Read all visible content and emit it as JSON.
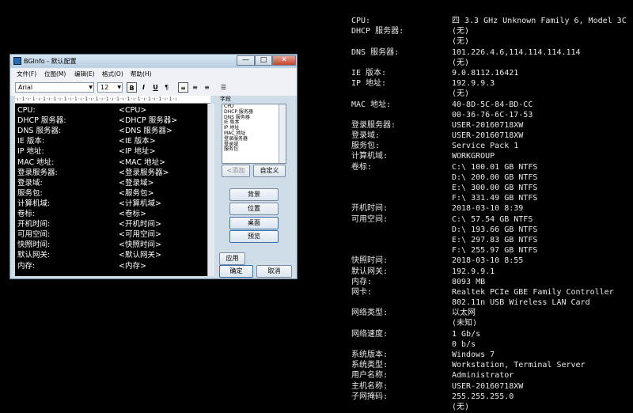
{
  "info": [
    {
      "k": "CPU:",
      "v": "四 3.3 GHz Unknown Family 6, Model 3C"
    },
    {
      "k": "DHCP 服务器:",
      "v": "(无)"
    },
    {
      "k": "",
      "v": "(无)"
    },
    {
      "k": "DNS 服务器:",
      "v": "101.226.4.6,114.114.114.114"
    },
    {
      "k": "",
      "v": "(无)"
    },
    {
      "k": "IE 版本:",
      "v": "9.0.8112.16421"
    },
    {
      "k": "IP 地址:",
      "v": "192.9.9.3"
    },
    {
      "k": "",
      "v": "(无)"
    },
    {
      "k": "MAC 地址:",
      "v": "40-8D-5C-84-BD-CC"
    },
    {
      "k": "",
      "v": "00-36-76-6C-17-53"
    },
    {
      "k": "登录服务器:",
      "v": "USER-20160718XW"
    },
    {
      "k": "登录域:",
      "v": "USER-20160718XW"
    },
    {
      "k": "服务包:",
      "v": "Service Pack 1"
    },
    {
      "k": "计算机域:",
      "v": "WORKGROUP"
    },
    {
      "k": "卷标:",
      "v": "C:\\ 100.01 GB NTFS"
    },
    {
      "k": "",
      "v": "D:\\ 200.00 GB NTFS"
    },
    {
      "k": "",
      "v": "E:\\ 300.00 GB NTFS"
    },
    {
      "k": "",
      "v": "F:\\ 331.49 GB NTFS"
    },
    {
      "k": "开机时间:",
      "v": "2018-03-10 8:39"
    },
    {
      "k": "可用空间:",
      "v": "C:\\ 57.54 GB NTFS"
    },
    {
      "k": "",
      "v": "D:\\ 193.66 GB NTFS"
    },
    {
      "k": "",
      "v": "E:\\ 297.83 GB NTFS"
    },
    {
      "k": "",
      "v": "F:\\ 255.97 GB NTFS"
    },
    {
      "k": "快照时间:",
      "v": "2018-03-10 8:55"
    },
    {
      "k": "默认网关:",
      "v": "192.9.9.1"
    },
    {
      "k": "内存:",
      "v": "8093 MB"
    },
    {
      "k": "网卡:",
      "v": "Realtek PCIe GBE Family Controller"
    },
    {
      "k": "",
      "v": "802.11n USB Wireless LAN Card"
    },
    {
      "k": "网络类型:",
      "v": "以太网"
    },
    {
      "k": "",
      "v": "(未知)"
    },
    {
      "k": "网络速度:",
      "v": "1 Gb/s"
    },
    {
      "k": "",
      "v": "0 b/s"
    },
    {
      "k": "系统版本:",
      "v": "Windows 7"
    },
    {
      "k": "系统类型:",
      "v": "Workstation, Terminal Server"
    },
    {
      "k": "用户名称:",
      "v": "Administrator"
    },
    {
      "k": "主机名称:",
      "v": "USER-20160718XW"
    },
    {
      "k": "子网掩码:",
      "v": "255.255.255.0"
    },
    {
      "k": "",
      "v": "(无)"
    }
  ],
  "window": {
    "title": "BGInfo - 默认配置",
    "min": "—",
    "max": "□",
    "close": "✕",
    "menus": [
      "文件(F)",
      "位图(M)",
      "编辑(E)",
      "格式(O)",
      "帮助(H)"
    ],
    "font": "Arial",
    "size": "12",
    "bold": "B",
    "italic": "I",
    "underline": "U",
    "ruler": "·ı·1·ı·1·ı·1·ı·1·ı·1·ı·1·ı·1·ı·1·ı·1·ı·1·ı·1·ı·1·ı·1·ı·1·ı·1·ı",
    "editor": [
      {
        "k": "CPU:",
        "v": "<CPU>"
      },
      {
        "k": "DHCP 服务器:",
        "v": "<DHCP 服务器>"
      },
      {
        "k": "DNS 服务器:",
        "v": "<DNS 服务器>"
      },
      {
        "k": "IE 版本:",
        "v": "<IE 版本>"
      },
      {
        "k": "IP 地址:",
        "v": "<IP 地址>"
      },
      {
        "k": "MAC 地址:",
        "v": "<MAC 地址>"
      },
      {
        "k": "登录服务器:",
        "v": "<登录服务器>"
      },
      {
        "k": "登录域:",
        "v": "<登录域>"
      },
      {
        "k": "服务包:",
        "v": "<服务包>"
      },
      {
        "k": "计算机域:",
        "v": "<计算机域>"
      },
      {
        "k": "卷标:",
        "v": "<卷标>"
      },
      {
        "k": "开机时间:",
        "v": "<开机时间>"
      },
      {
        "k": "可用空间:",
        "v": "<可用空间>"
      },
      {
        "k": "快照时间:",
        "v": "<快照时间>"
      },
      {
        "k": "默认网关:",
        "v": "<默认网关>"
      },
      {
        "k": "内存:",
        "v": "<内存>"
      }
    ],
    "fields_label": "字段",
    "fields": [
      "CPU",
      "DHCP 服务器",
      "DNS 服务器",
      "IE 版本",
      "IP 地址",
      "MAC 地址",
      "登录服务器",
      "登录域",
      "服务包"
    ],
    "add": "<添加",
    "custom": "自定义",
    "background": "背景",
    "position": "位置",
    "desktop": "桌面",
    "preview": "预览",
    "apply": "应用",
    "ok": "确定",
    "cancel": "取消"
  }
}
